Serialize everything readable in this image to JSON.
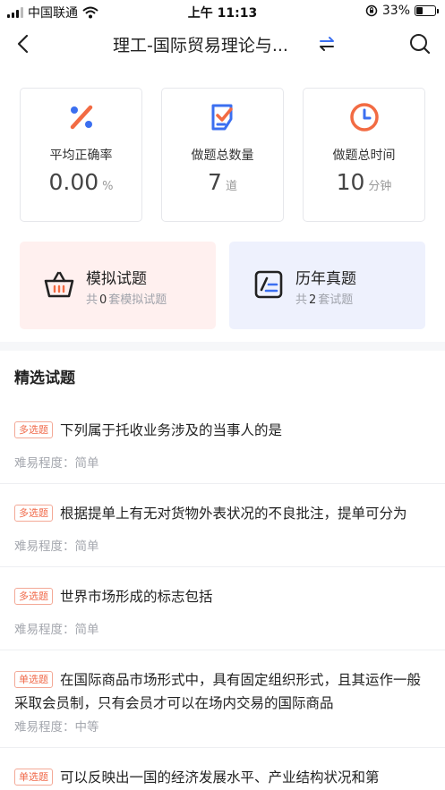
{
  "status_bar": {
    "carrier": "中国联通",
    "time": "上午 11:13",
    "battery": "33%",
    "battery_level": 0.33
  },
  "nav": {
    "title": "理工-国际贸易理论与...",
    "back_icon": "chevron-left-icon",
    "switch_icon": "swap-icon",
    "search_icon": "search-icon"
  },
  "stats": [
    {
      "label": "平均正确率",
      "value": "0.00",
      "unit": "%",
      "icon": "percent-icon"
    },
    {
      "label": "做题总数量",
      "value": "7",
      "unit": "道",
      "icon": "checklist-icon"
    },
    {
      "label": "做题总时间",
      "value": "10",
      "unit": "分钟",
      "icon": "clock-icon"
    }
  ],
  "practice": [
    {
      "title": "模拟试题",
      "prefix": "共",
      "count": "0",
      "suffix": "套模拟试题",
      "icon": "basket-icon"
    },
    {
      "title": "历年真题",
      "prefix": "共",
      "count": "2",
      "suffix": "套试题",
      "icon": "exam-paper-icon"
    }
  ],
  "section_title": "精选试题",
  "questions": [
    {
      "tag": "多选题",
      "text": "下列属于托收业务涉及的当事人的是",
      "difficulty": "难易程度：简单"
    },
    {
      "tag": "多选题",
      "text": "根据提单上有无对货物外表状况的不良批注，提单可分为",
      "difficulty": "难易程度：简单"
    },
    {
      "tag": "多选题",
      "text": "世界市场形成的标志包括",
      "difficulty": "难易程度：简单"
    },
    {
      "tag": "单选题",
      "text": "在国际商品市场形式中，具有固定组织形式，且其运作一般采取会员制，只有会员才可以在场内交易的国际商品",
      "difficulty": "难易程度：中等"
    },
    {
      "tag": "单选题",
      "text": "可以反映出一国的经济发展水平、产业结构状况和第",
      "difficulty": ""
    }
  ],
  "colors": {
    "accent_orange": "#f26b43",
    "accent_blue": "#3b6ff0",
    "pink_bg": "#fff0ef",
    "blue_bg": "#eef1fd"
  }
}
